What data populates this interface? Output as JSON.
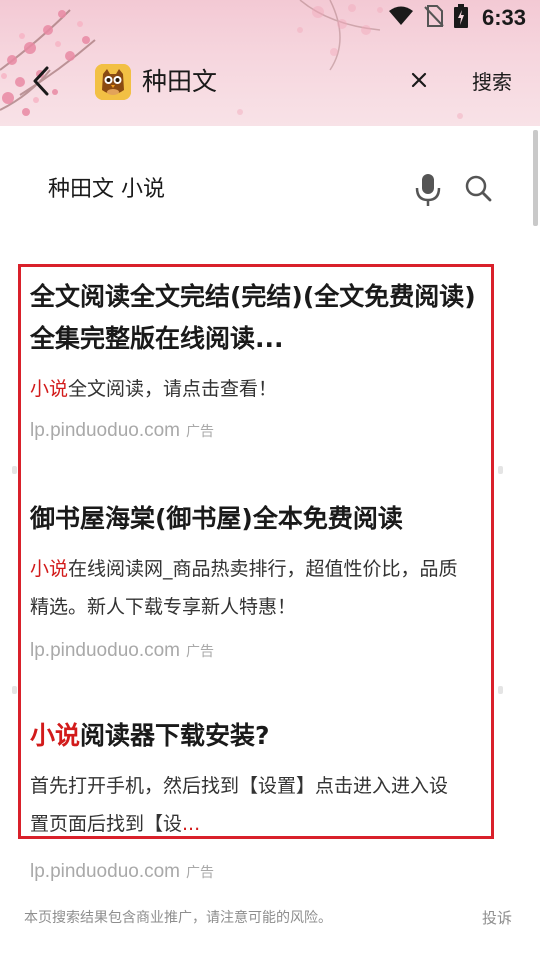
{
  "status_bar": {
    "time": "6:33",
    "icons": [
      "wifi-icon",
      "no-sim-icon",
      "battery-charging-icon"
    ]
  },
  "toolbar": {
    "back_icon": "chevron-left-icon",
    "app_icon": "owl-logo-icon",
    "title": "种田文",
    "clear_icon": "close-icon",
    "search_label": "搜索"
  },
  "search": {
    "query": "种田文 小说",
    "icons": [
      "microphone-icon",
      "search-icon"
    ]
  },
  "results": [
    {
      "title_lines": [
        "全文阅读全文完结(完结)(全文免费阅读)",
        "全集完整版在线阅读..."
      ],
      "snippet_highlight": "小说",
      "snippet_rest_lines": [
        "全文阅读，请点击查看！"
      ],
      "source": "lp.pinduoduo.com",
      "ad_label": "广告"
    },
    {
      "title_lines": [
        "御书屋海棠(御书屋)全本免费阅读"
      ],
      "snippet_highlight": "小说",
      "snippet_rest_lines": [
        "在线阅读网_商品热卖排行，超值性价比，品质",
        "精选。新人下载专享新人特惠！"
      ],
      "source": "lp.pinduoduo.com",
      "ad_label": "广告"
    },
    {
      "title_highlight": "小说",
      "title_rest": "阅读器下载安装?",
      "snippet_lines": [
        "首先打开手机，然后找到【设置】点击进入进入设",
        "置页面后找到【设"
      ],
      "snippet_ellipsis": "...",
      "source": "lp.pinduoduo.com",
      "ad_label": "广告"
    }
  ],
  "footer": {
    "notice": "本页搜索结果包含商业推广，请注意可能的风险。",
    "report_label": "投诉"
  },
  "colors": {
    "highlight": "#d21b1b",
    "frame": "#d9202a",
    "header_pink": "#f3c9d4"
  }
}
